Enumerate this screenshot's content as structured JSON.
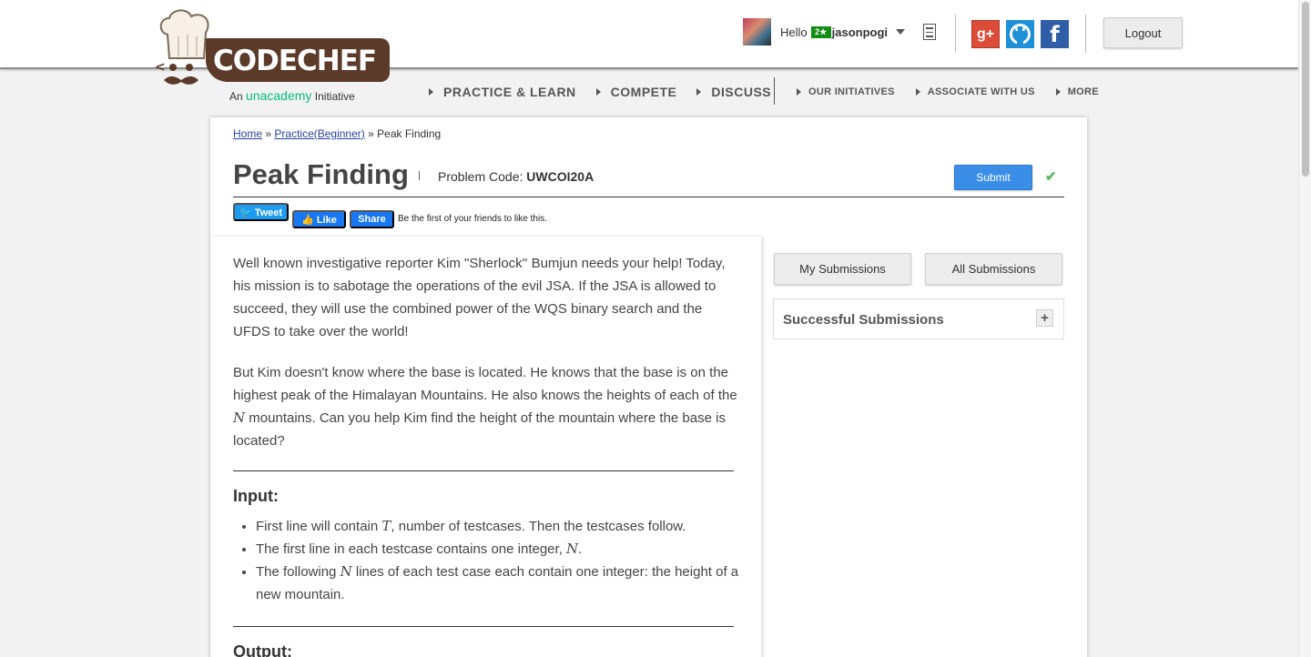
{
  "brand": {
    "logo_text": "CODECHEF",
    "tagline_prefix": "An",
    "tagline_brand": "unacademy",
    "tagline_suffix": "Initiative"
  },
  "user": {
    "greeting": "Hello",
    "rating_badge": "2★",
    "username": "jasonpogi"
  },
  "social": {
    "google_label": "g+",
    "facebook_label": "f"
  },
  "header": {
    "logout_label": "Logout"
  },
  "nav": {
    "main": [
      "PRACTICE & LEARN",
      "COMPETE",
      "DISCUSS"
    ],
    "sub": [
      "OUR INITIATIVES",
      "ASSOCIATE WITH US",
      "MORE"
    ]
  },
  "breadcrumb": {
    "home": "Home",
    "sep": "»",
    "practice": "Practice(Beginner)",
    "current": "Peak Finding"
  },
  "problem": {
    "title": "Peak Finding",
    "code_label": "Problem Code:",
    "code": "UWCOI20A",
    "submit_label": "Submit",
    "solved_mark": "✔"
  },
  "share": {
    "tweet_label": "Tweet",
    "like_label": "Like",
    "share_label": "Share",
    "like_text": "Be the first of your friends to like this."
  },
  "statement": {
    "p1": "Well known investigative reporter Kim \"Sherlock'' Bumjun needs your help! Today, his mission is to sabotage the operations of the evil JSA. If the JSA is allowed to succeed, they will use the combined power of the WQS binary search and the UFDS to take over the world!",
    "p2_a": "But Kim doesn't know where the base is located. He knows that the base is on the highest peak of the Himalayan Mountains. He also knows the heights of each of the ",
    "p2_var": "N",
    "p2_b": " mountains. Can you help Kim find the height of the mountain where the base is located?",
    "input_heading": "Input:",
    "input_items": [
      {
        "a": "First line will contain ",
        "v": "T",
        "b": ", number of testcases. Then the testcases follow."
      },
      {
        "a": "The first line in each testcase contains one integer, ",
        "v": "N",
        "b": "."
      },
      {
        "a": "The following ",
        "v": "N",
        "b": " lines of each test case each contain one integer: the height of a new mountain."
      }
    ],
    "output_heading": "Output:"
  },
  "sidebar": {
    "my_submissions": "My Submissions",
    "all_submissions": "All Submissions",
    "successful_submissions": "Successful Submissions",
    "expand_symbol": "+"
  }
}
